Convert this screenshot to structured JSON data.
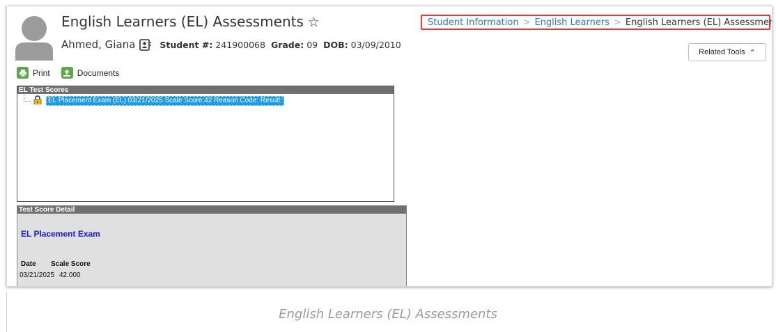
{
  "header": {
    "title": "English Learners (EL) Assessments",
    "student_name": "Ahmed, Giana",
    "student_number_label": "Student #:",
    "student_number": "241900068",
    "grade_label": "Grade:",
    "grade": "09",
    "dob_label": "DOB:",
    "dob": "03/09/2010"
  },
  "breadcrumb": {
    "items": [
      "Student Information",
      "English Learners",
      "English Learners (EL) Assessments"
    ]
  },
  "related_tools": {
    "label": "Related Tools"
  },
  "toolbar": {
    "print_label": "Print",
    "documents_label": "Documents"
  },
  "test_scores": {
    "header": "EL Test Scores",
    "items": [
      "EL Placement Exam (EL) 03/21/2025 Scale Score:42 Reason Code: Result:"
    ]
  },
  "detail": {
    "header": "Test Score Detail",
    "exam_title": "EL Placement Exam",
    "columns": [
      "Date",
      "Scale Score"
    ],
    "rows": [
      [
        "03/21/2025",
        "42.000"
      ]
    ]
  },
  "caption": "English Learners (EL) Assessments",
  "colors": {
    "breadcrumb_link": "#2f77b6",
    "highlight": "#e53935",
    "selection": "#1a9bf0",
    "tool_icon": "#5aa847"
  }
}
